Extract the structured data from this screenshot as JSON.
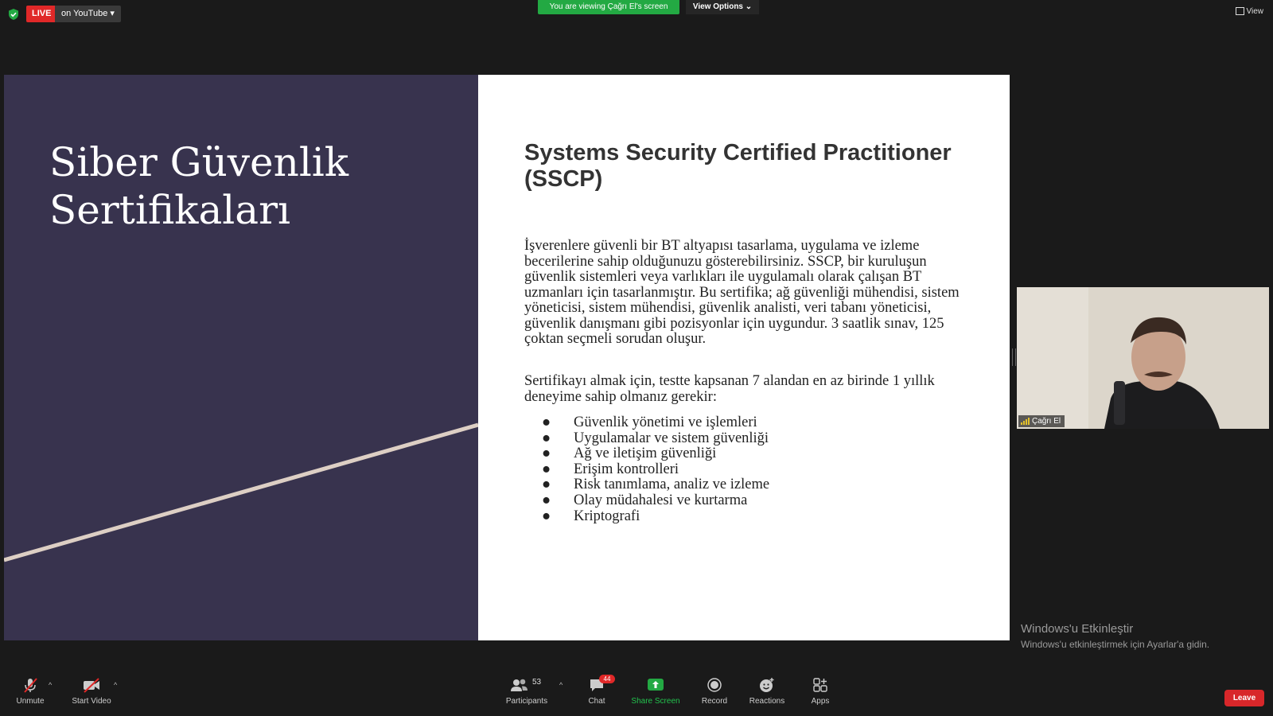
{
  "top_bar": {
    "live_label": "LIVE",
    "live_destination": "on YouTube ▾",
    "viewing_banner": "You are viewing Çağrı El's screen",
    "view_options": "View Options ⌄",
    "view_label": "View"
  },
  "slide": {
    "title": "Siber Güvenlik Sertifikaları",
    "cert_title": "Systems Security Certified Practitioner (SSCP)",
    "description": "İşverenlere güvenli bir BT altyapısı tasarlama, uygulama ve izleme becerilerine sahip olduğunuzu gösterebilirsiniz. SSCP, bir kuruluşun güvenlik sistemleri veya varlıkları ile uygulamalı olarak çalışan BT uzmanları için tasarlanmıştır. Bu sertifika; ağ güvenliği mühendisi, sistem yöneticisi, sistem mühendisi, güvenlik analisti, veri tabanı yöneticisi, güvenlik danışmanı gibi pozisyonlar için uygundur. 3 saatlik sınav, 125 çoktan seçmeli sorudan oluşur.",
    "requirement": "Sertifikayı almak için, testte kapsanan 7 alandan en az birinde 1 yıllık deneyime sahip olmanız gerekir:",
    "domains": [
      "Güvenlik yönetimi ve işlemleri",
      "Uygulamalar ve sistem güvenliği",
      "Ağ ve iletişim güvenliği",
      "Erişim kontrolleri",
      "Risk tanımlama, analiz ve izleme",
      "Olay müdahalesi ve kurtarma",
      "Kriptografi"
    ],
    "bullet": "●"
  },
  "video": {
    "participant_name": "Çağrı El"
  },
  "watermark": {
    "title": "Windows'u Etkinleştir",
    "subtitle": "Windows'u etkinleştirmek için Ayarlar'a gidin."
  },
  "toolbar": {
    "unmute": "Unmute",
    "start_video": "Start Video",
    "participants": "Participants",
    "participant_count": "53",
    "chat": "Chat",
    "chat_badge": "44",
    "share_screen": "Share Screen",
    "record": "Record",
    "reactions": "Reactions",
    "apps": "Apps",
    "leave": "Leave",
    "caret": "^"
  },
  "colors": {
    "live_red": "#e02828",
    "share_green": "#23a943",
    "slide_purple": "#38334e"
  }
}
